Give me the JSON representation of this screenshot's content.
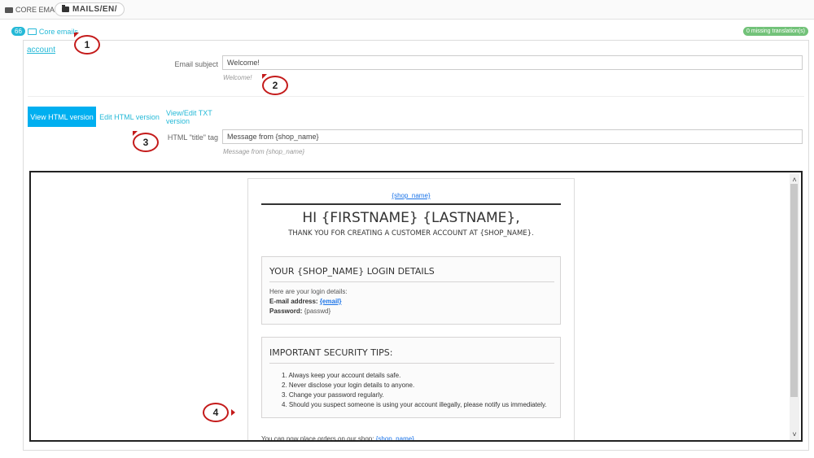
{
  "breadcrumb": {
    "first": "CORE EMAILS",
    "second": "MAILS/EN/"
  },
  "core_emails": {
    "count": "66",
    "label": "Core emails"
  },
  "missing_badge": "0 missing translation(s)",
  "template_name": "account",
  "email_subject": {
    "label": "Email subject",
    "value": "Welcome!",
    "hint": "Welcome!"
  },
  "tabs": [
    {
      "label": "View HTML version",
      "active": true
    },
    {
      "label": "Edit HTML version",
      "active": false
    },
    {
      "label": "View/Edit TXT version",
      "active": false
    }
  ],
  "title_tag": {
    "label": "HTML \"title\" tag",
    "value": "Message from {shop_name}",
    "hint": "Message from {shop_name}"
  },
  "preview": {
    "shop_link": "{shop_name}",
    "greeting": "HI {FIRSTNAME} {LASTNAME},",
    "thanks": "THANK YOU FOR CREATING A CUSTOMER ACCOUNT AT {SHOP_NAME}.",
    "login": {
      "title": "YOUR {SHOP_NAME} LOGIN DETAILS",
      "intro": "Here are your login details:",
      "email_label": "E-mail address:",
      "email_value": "{email}",
      "password_label": "Password:",
      "password_value": "{passwd}"
    },
    "security": {
      "title": "IMPORTANT SECURITY TIPS:",
      "tips": [
        "1. Always keep your account details safe.",
        "2. Never disclose your login details to anyone.",
        "3. Change your password regularly.",
        "4. Should you suspect someone is using your account illegally, please notify us immediately."
      ]
    },
    "footer_text": "You can now place orders on our shop:",
    "footer_link": "{shop_name}"
  },
  "callouts": [
    "1",
    "2",
    "3",
    "4"
  ],
  "colors": {
    "accent": "#25b9d7",
    "tab_active": "#00aff0",
    "badge_green": "#72c279",
    "callout_red": "#c41b1b"
  }
}
